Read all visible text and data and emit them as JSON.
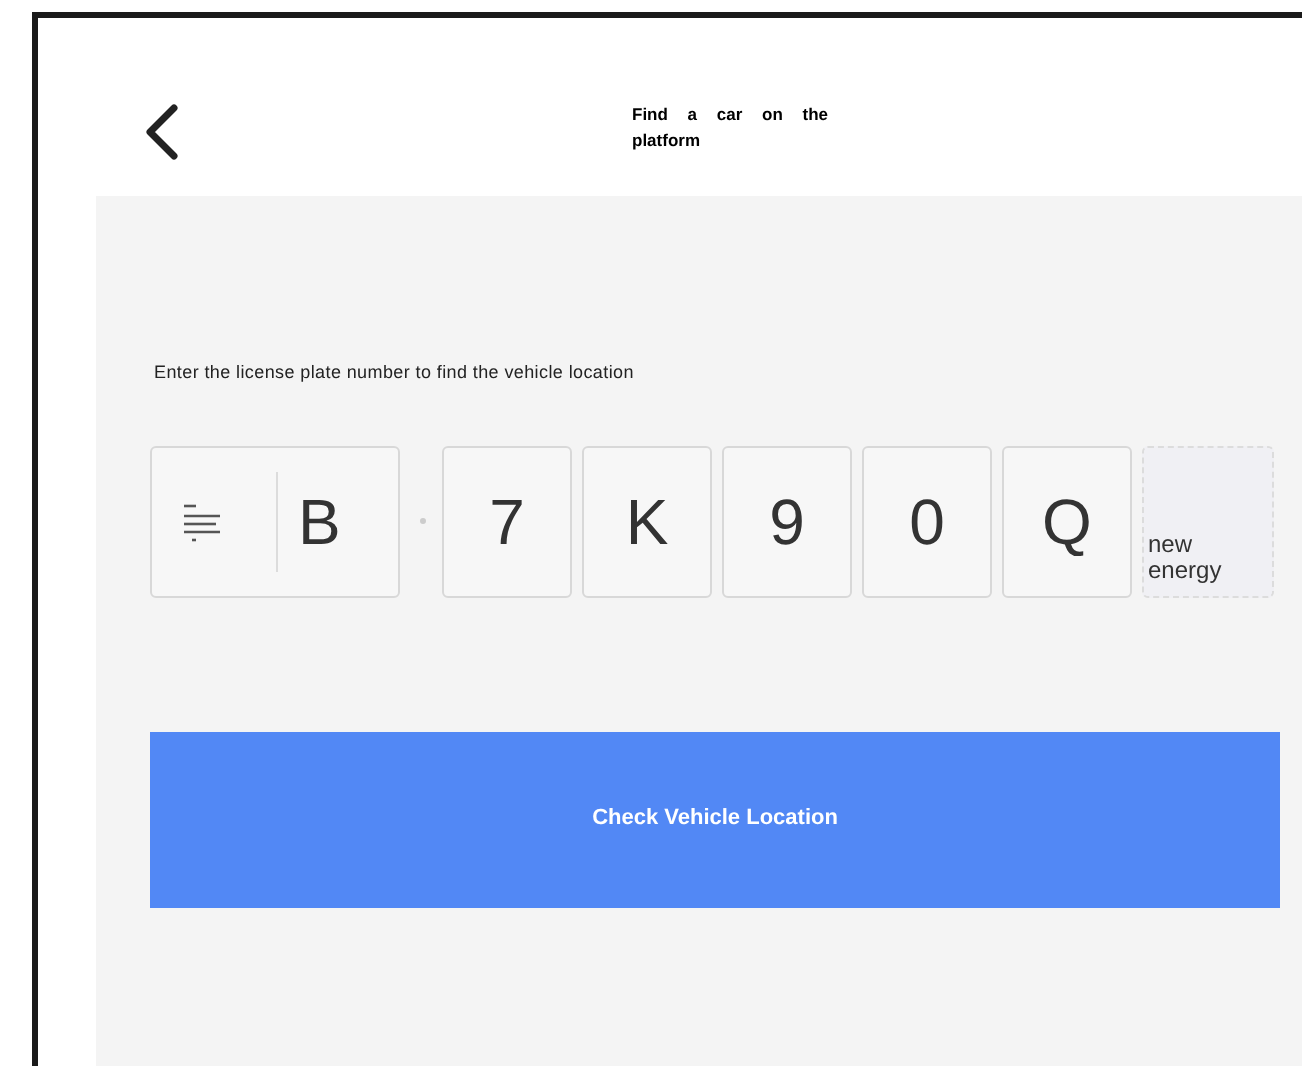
{
  "header": {
    "title": "Find a car on the platform"
  },
  "prompt": "Enter the license plate number to find the vehicle location",
  "plate": {
    "region_letter": "B",
    "characters": [
      {
        "char": "7",
        "selected": false
      },
      {
        "char": "K",
        "selected": false
      },
      {
        "char": "9",
        "selected": false
      },
      {
        "char": "0",
        "selected": false
      },
      {
        "char": "Q",
        "selected": false
      }
    ],
    "new_energy_label": "new energy"
  },
  "button": "Check Vehicle Location"
}
